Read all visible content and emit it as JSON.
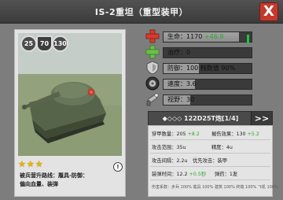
{
  "title": "IS-2重坦（重型装甲）",
  "close_label": "X",
  "card": {
    "badges": [
      "25",
      "70",
      "130"
    ],
    "stars": 3,
    "info_label": "!",
    "description_lines": [
      "被兵营升路线：履具-防御：",
      "偏向血量、装弹"
    ]
  },
  "stats": [
    {
      "icon": "hp-cross-icon",
      "label": "生命：1170",
      "bonus": "+46.8",
      "fill": 0.86
    },
    {
      "icon": "heal-cross-icon",
      "label": "治疗：0",
      "bonus": "",
      "fill": 0.0
    },
    {
      "icon": "armor-shield-icon",
      "label": "防御：100     韩数值 90%",
      "bonus": "",
      "fill": 0.4
    },
    {
      "icon": "speed-tire-icon",
      "label": "速度：3.6",
      "bonus": "",
      "fill": 0.36
    },
    {
      "icon": "vision-scope-icon",
      "label": "视野：30",
      "bonus": "",
      "fill": 0.3
    }
  ],
  "weapon": {
    "name": "◆◇◇◇ 122D25T炮[1/4]",
    "next_label": ">>",
    "rows": [
      {
        "items": [
          {
            "label": "穿甲数量：",
            "value": "205",
            "bonus": "+8.2"
          },
          {
            "label": "摧伤效果：",
            "value": "130",
            "bonus": "+5.2"
          }
        ]
      },
      {
        "items": [
          {
            "label": "攻击范围：",
            "value": "35u",
            "bonus": ""
          },
          {
            "label": "精度：",
            "value": "4u",
            "bonus": ""
          }
        ]
      },
      {
        "items": [
          {
            "label": "攻击间隔：",
            "value": "2.2u",
            "bonus": ""
          },
          {
            "label": "优先攻击：",
            "value": "装甲",
            "bonus": ""
          }
        ]
      },
      {
        "items": [
          {
            "label": "装弹时间：",
            "value": "12.2",
            "bonus": "+0.5秒"
          },
          {
            "label": "弹药：",
            "value": "1发",
            "bonus": ""
          }
        ]
      }
    ],
    "damage_note": "伤害系数：步兵 100%  载具 100%  建筑 100%  终端 100%  飞机 100%"
  },
  "colors": {
    "hp_cap": "#22c04a",
    "bonus": "#2ea82e",
    "close": "#c23a2e",
    "star": "#e8b400"
  }
}
